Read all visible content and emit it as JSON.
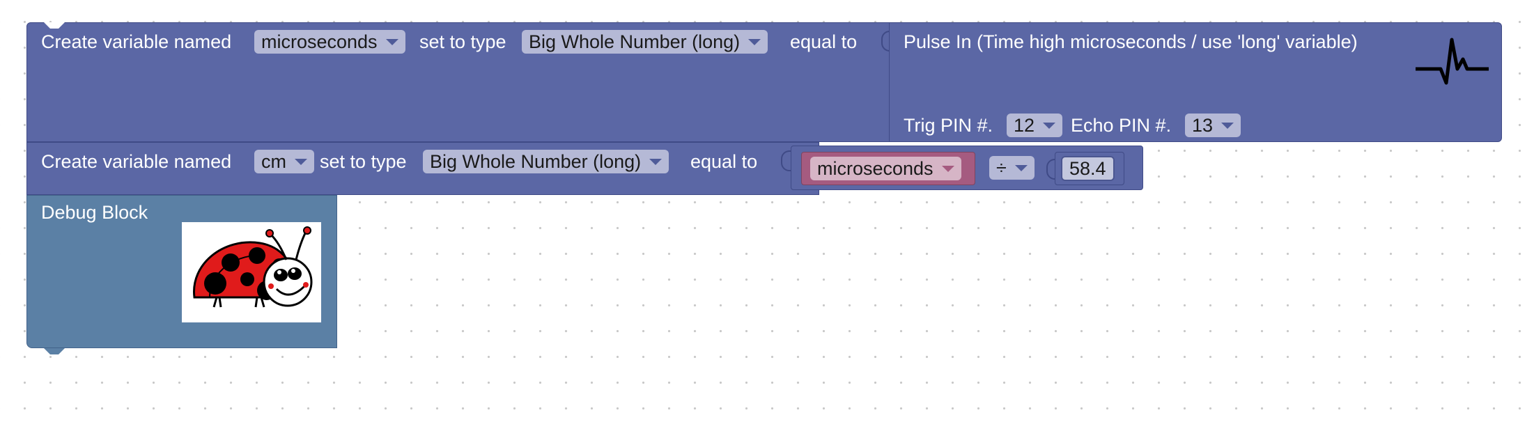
{
  "blocks": {
    "var1": {
      "create_label": "Create variable named",
      "var_name": "microseconds",
      "set_label": "set to type",
      "type_value": "Big Whole Number (long)",
      "equal_label": "equal to"
    },
    "pulse": {
      "title": "Pulse In (Time high microseconds / use 'long' variable)",
      "trig_label": "Trig PIN #.",
      "trig_value": "12",
      "echo_label": "Echo PIN #.",
      "echo_value": "13",
      "icon": "pulse-waveform-icon"
    },
    "var2": {
      "create_label": "Create variable named",
      "var_name": "cm",
      "set_label": "set to type",
      "type_value": "Big Whole Number (long)",
      "equal_label": "equal to"
    },
    "math": {
      "variable": "microseconds",
      "operator": "÷",
      "number": "58.4"
    },
    "debug": {
      "title": "Debug Block",
      "image_icon": "ladybug-icon"
    }
  },
  "colors": {
    "block_blue": "#5b67a5",
    "debug_block": "#5b80a5",
    "variable_pink": "#a55b80",
    "workspace": "#ffffff"
  }
}
